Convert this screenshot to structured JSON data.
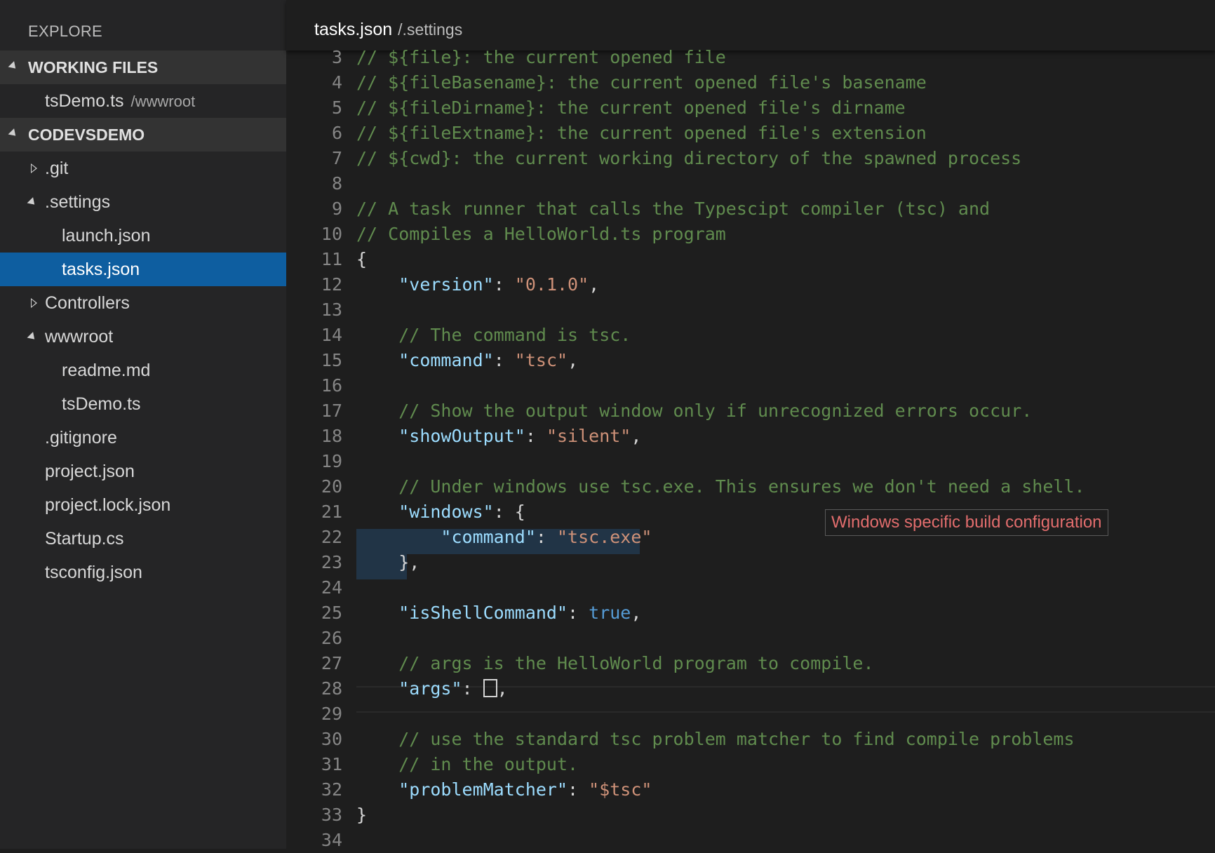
{
  "sidebar": {
    "title": "EXPLORE",
    "working_files": {
      "label": "WORKING FILES",
      "items": [
        {
          "name": "tsDemo.ts",
          "path": "/wwwroot"
        }
      ]
    },
    "project": {
      "label": "CODEVSDEMO",
      "tree": [
        {
          "name": ".git",
          "depth": 1,
          "type": "folder-collapsed"
        },
        {
          "name": ".settings",
          "depth": 1,
          "type": "folder-expanded"
        },
        {
          "name": "launch.json",
          "depth": 2,
          "type": "file"
        },
        {
          "name": "tasks.json",
          "depth": 2,
          "type": "file",
          "selected": true
        },
        {
          "name": "Controllers",
          "depth": 1,
          "type": "folder-collapsed"
        },
        {
          "name": "wwwroot",
          "depth": 1,
          "type": "folder-expanded"
        },
        {
          "name": "readme.md",
          "depth": 2,
          "type": "file"
        },
        {
          "name": "tsDemo.ts",
          "depth": 2,
          "type": "file"
        },
        {
          "name": ".gitignore",
          "depth": 1,
          "type": "file"
        },
        {
          "name": "project.json",
          "depth": 1,
          "type": "file"
        },
        {
          "name": "project.lock.json",
          "depth": 1,
          "type": "file"
        },
        {
          "name": "Startup.cs",
          "depth": 1,
          "type": "file"
        },
        {
          "name": "tsconfig.json",
          "depth": 1,
          "type": "file"
        }
      ]
    }
  },
  "editor": {
    "tab": {
      "title": "tasks.json",
      "path": "/.settings"
    },
    "hover_message": "Windows specific build configuration",
    "lines": [
      {
        "n": "3",
        "tokens": [
          [
            "comment",
            "// ${file}: the current opened file"
          ]
        ]
      },
      {
        "n": "4",
        "tokens": [
          [
            "comment",
            "// ${fileBasename}: the current opened file's basename"
          ]
        ]
      },
      {
        "n": "5",
        "tokens": [
          [
            "comment",
            "// ${fileDirname}: the current opened file's dirname"
          ]
        ]
      },
      {
        "n": "6",
        "tokens": [
          [
            "comment",
            "// ${fileExtname}: the current opened file's extension"
          ]
        ]
      },
      {
        "n": "7",
        "tokens": [
          [
            "comment",
            "// ${cwd}: the current working directory of the spawned process"
          ]
        ]
      },
      {
        "n": "8",
        "tokens": []
      },
      {
        "n": "9",
        "tokens": [
          [
            "comment",
            "// A task runner that calls the Typescipt compiler (tsc) and"
          ]
        ]
      },
      {
        "n": "10",
        "tokens": [
          [
            "comment",
            "// Compiles a HelloWorld.ts program"
          ]
        ]
      },
      {
        "n": "11",
        "tokens": [
          [
            "punc",
            "{"
          ]
        ]
      },
      {
        "n": "12",
        "tokens": [
          [
            "punc",
            "    "
          ],
          [
            "key",
            "\"version\""
          ],
          [
            "punc",
            ": "
          ],
          [
            "str",
            "\"0.1.0\""
          ],
          [
            "punc",
            ","
          ]
        ]
      },
      {
        "n": "13",
        "tokens": []
      },
      {
        "n": "14",
        "tokens": [
          [
            "punc",
            "    "
          ],
          [
            "comment",
            "// The command is tsc."
          ]
        ]
      },
      {
        "n": "15",
        "tokens": [
          [
            "punc",
            "    "
          ],
          [
            "key",
            "\"command\""
          ],
          [
            "punc",
            ": "
          ],
          [
            "str",
            "\"tsc\""
          ],
          [
            "punc",
            ","
          ]
        ]
      },
      {
        "n": "16",
        "tokens": []
      },
      {
        "n": "17",
        "tokens": [
          [
            "punc",
            "    "
          ],
          [
            "comment",
            "// Show the output window only if unrecognized errors occur."
          ]
        ]
      },
      {
        "n": "18",
        "tokens": [
          [
            "punc",
            "    "
          ],
          [
            "key",
            "\"showOutput\""
          ],
          [
            "punc",
            ": "
          ],
          [
            "str",
            "\"silent\""
          ],
          [
            "punc",
            ","
          ]
        ]
      },
      {
        "n": "19",
        "tokens": []
      },
      {
        "n": "20",
        "tokens": [
          [
            "punc",
            "    "
          ],
          [
            "comment",
            "// Under windows use tsc.exe. This ensures we don't need a shell."
          ]
        ]
      },
      {
        "n": "21",
        "tokens": [
          [
            "punc",
            "    "
          ],
          [
            "key",
            "\"windows\""
          ],
          [
            "punc",
            ": {"
          ]
        ]
      },
      {
        "n": "22",
        "tokens": [
          [
            "punc",
            "        "
          ],
          [
            "key",
            "\"command\""
          ],
          [
            "punc",
            ": "
          ],
          [
            "str",
            "\"tsc.exe\""
          ]
        ]
      },
      {
        "n": "23",
        "tokens": [
          [
            "punc",
            "    },"
          ]
        ]
      },
      {
        "n": "24",
        "tokens": []
      },
      {
        "n": "25",
        "tokens": [
          [
            "punc",
            "    "
          ],
          [
            "key",
            "\"isShellCommand\""
          ],
          [
            "punc",
            ": "
          ],
          [
            "kw",
            "true"
          ],
          [
            "punc",
            ","
          ]
        ]
      },
      {
        "n": "26",
        "tokens": []
      },
      {
        "n": "27",
        "tokens": [
          [
            "punc",
            "    "
          ],
          [
            "comment",
            "// args is the HelloWorld program to compile."
          ]
        ]
      },
      {
        "n": "28",
        "tokens": [
          [
            "punc",
            "    "
          ],
          [
            "key",
            "\"args\""
          ],
          [
            "punc",
            ": "
          ],
          [
            "bracket",
            ""
          ],
          [
            "punc",
            ","
          ]
        ]
      },
      {
        "n": "29",
        "tokens": []
      },
      {
        "n": "30",
        "tokens": [
          [
            "punc",
            "    "
          ],
          [
            "comment",
            "// use the standard tsc problem matcher to find compile problems"
          ]
        ]
      },
      {
        "n": "31",
        "tokens": [
          [
            "punc",
            "    "
          ],
          [
            "comment",
            "// in the output."
          ]
        ]
      },
      {
        "n": "32",
        "tokens": [
          [
            "punc",
            "    "
          ],
          [
            "key",
            "\"problemMatcher\""
          ],
          [
            "punc",
            ": "
          ],
          [
            "str",
            "\"$tsc\""
          ]
        ]
      },
      {
        "n": "33",
        "tokens": [
          [
            "punc",
            "}"
          ]
        ]
      },
      {
        "n": "34",
        "tokens": []
      }
    ]
  }
}
